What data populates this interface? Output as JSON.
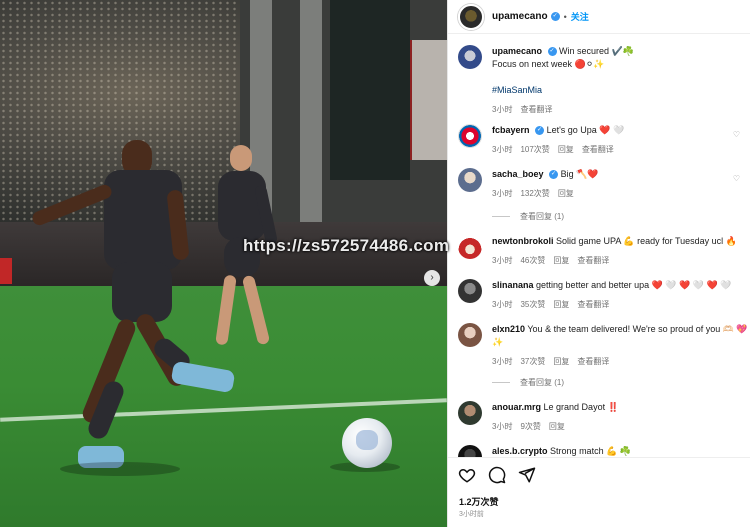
{
  "watermark": "https://zs572574486.com",
  "post": {
    "author": "upamecano",
    "follow_label": "关注",
    "caption_line1": "Win secured ✔️☘️",
    "caption_line2": "Focus on next week 🔴⚪✨",
    "hashtag": "#MiaSanMia",
    "time": "3小时",
    "translate": "查看翻译"
  },
  "comments": [
    {
      "user": "fcbayern",
      "text": "Let's go Upa ❤️ 🤍",
      "time": "3小时",
      "likes": "107次赞",
      "reply": "回复",
      "translate": "查看翻译"
    },
    {
      "user": "sacha_boey",
      "text": "Big 🪓❤️",
      "time": "3小时",
      "likes": "132次赞",
      "reply": "回复",
      "replies": "查看回复 (1)"
    },
    {
      "user": "newtonbrokoli",
      "text": "Solid game UPA 💪 ready for Tuesday ucl 🔥",
      "time": "3小时",
      "likes": "46次赞",
      "reply": "回复",
      "translate": "查看翻译"
    },
    {
      "user": "slinanana",
      "text": "getting better and better upa ❤️ 🤍 ❤️ 🤍 ❤️ 🤍",
      "time": "3小时",
      "likes": "35次赞",
      "reply": "回复",
      "translate": "查看翻译"
    },
    {
      "user": "elxn210",
      "text": "You & the team delivered! We're so proud of you 🫶🏻 💖✨",
      "time": "3小时",
      "likes": "37次赞",
      "reply": "回复",
      "translate": "查看翻译",
      "replies": "查看回复 (1)"
    },
    {
      "user": "anouar.mrg",
      "text": "Le grand Dayot ‼️",
      "time": "3小时",
      "likes": "9次赞",
      "reply": "回复"
    },
    {
      "user": "ales.b.crypto",
      "text": "Strong match 💪 ☘️"
    }
  ],
  "footer": {
    "likes": "1.2万次赞",
    "time": "3小时前"
  },
  "icons": {
    "like": "heart-icon",
    "comment": "comment-icon",
    "share": "share-icon",
    "next": "chevron-right-icon",
    "verified": "verified-badge-icon"
  }
}
